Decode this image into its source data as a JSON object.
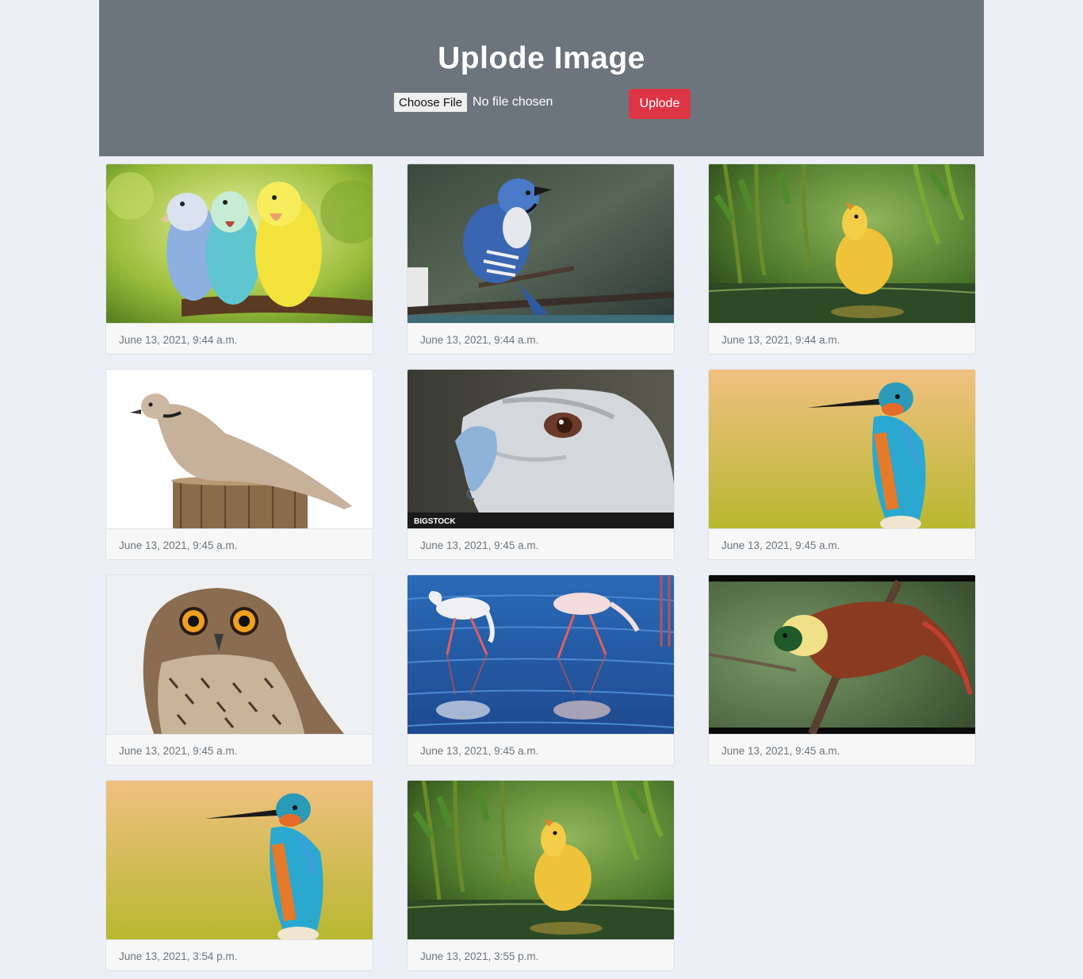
{
  "header": {
    "title": "Uplode Image",
    "choose_file_label": "Choose File",
    "no_file_text": "No file chosen",
    "upload_button_label": "Uplode"
  },
  "gallery": {
    "cards": [
      {
        "subject": "parakeets",
        "date": "June 13, 2021, 9:44 a.m."
      },
      {
        "subject": "blue-jay",
        "date": "June 13, 2021, 9:44 a.m."
      },
      {
        "subject": "duckling",
        "date": "June 13, 2021, 9:44 a.m."
      },
      {
        "subject": "dove",
        "date": "June 13, 2021, 9:45 a.m."
      },
      {
        "subject": "eagle",
        "date": "June 13, 2021, 9:45 a.m.",
        "watermark": "BIGSTOCK"
      },
      {
        "subject": "kingfisher",
        "date": "June 13, 2021, 9:45 a.m."
      },
      {
        "subject": "owl",
        "date": "June 13, 2021, 9:45 a.m."
      },
      {
        "subject": "flamingos",
        "date": "June 13, 2021, 9:45 a.m."
      },
      {
        "subject": "bird-of-paradise",
        "date": "June 13, 2021, 9:45 a.m."
      },
      {
        "subject": "kingfisher",
        "date": "June 13, 2021, 3:54 p.m."
      },
      {
        "subject": "duckling",
        "date": "June 13, 2021, 3:55 p.m."
      }
    ]
  },
  "colors": {
    "page_bg": "#eceff6",
    "header_bg": "#6c757d",
    "upload_button": "#dc3545",
    "date_text": "#6c757d"
  }
}
